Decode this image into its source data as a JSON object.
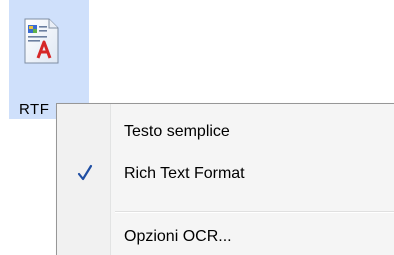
{
  "file": {
    "label": "RTF",
    "icon": "rtf-document-icon"
  },
  "context_menu": {
    "items": [
      {
        "label": "Testo semplice",
        "checked": false
      },
      {
        "label": "Rich Text Format",
        "checked": true
      },
      {
        "label": "Opzioni OCR..."
      }
    ],
    "check_icon": "checkmark-icon"
  },
  "colors": {
    "selection_tile": "#cfe0fb",
    "menu_background": "#f5f5f5",
    "check_color": "#1f4ea3"
  }
}
